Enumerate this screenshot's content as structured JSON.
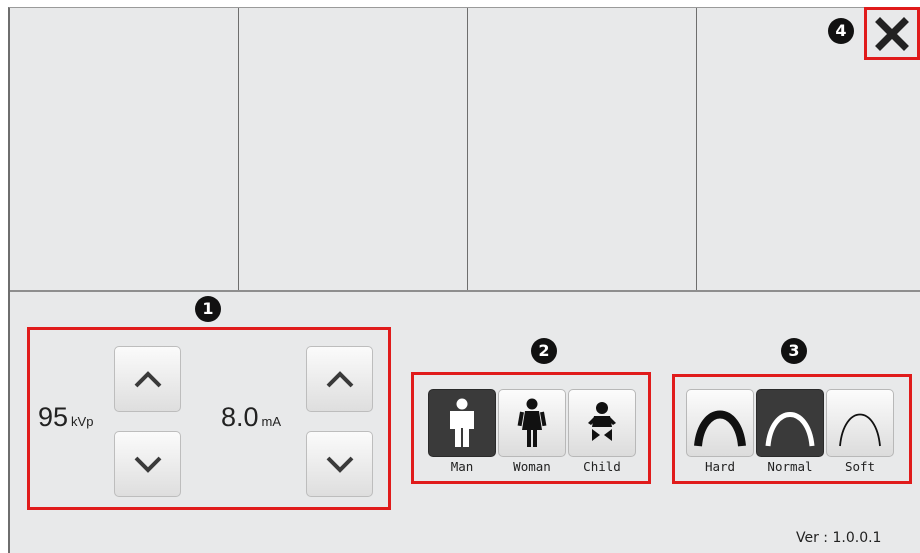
{
  "callouts": [
    "1",
    "2",
    "3",
    "4"
  ],
  "exposure": {
    "kvp": {
      "value": "95",
      "unit": "kVp"
    },
    "ma": {
      "value": "8.0",
      "unit": "mA"
    }
  },
  "patient_types": [
    {
      "label": "Man",
      "icon": "man-icon",
      "selected": true
    },
    {
      "label": "Woman",
      "icon": "woman-icon",
      "selected": false
    },
    {
      "label": "Child",
      "icon": "child-icon",
      "selected": false
    }
  ],
  "filters": [
    {
      "label": "Hard",
      "icon": "hard-curve-icon",
      "selected": false
    },
    {
      "label": "Normal",
      "icon": "normal-curve-icon",
      "selected": true
    },
    {
      "label": "Soft",
      "icon": "soft-curve-icon",
      "selected": false
    }
  ],
  "version": "Ver : 1.0.0.1",
  "colors": {
    "highlight": "#e01b1b",
    "background": "#e8e9ea",
    "selected_tile": "#3a3a3a"
  }
}
